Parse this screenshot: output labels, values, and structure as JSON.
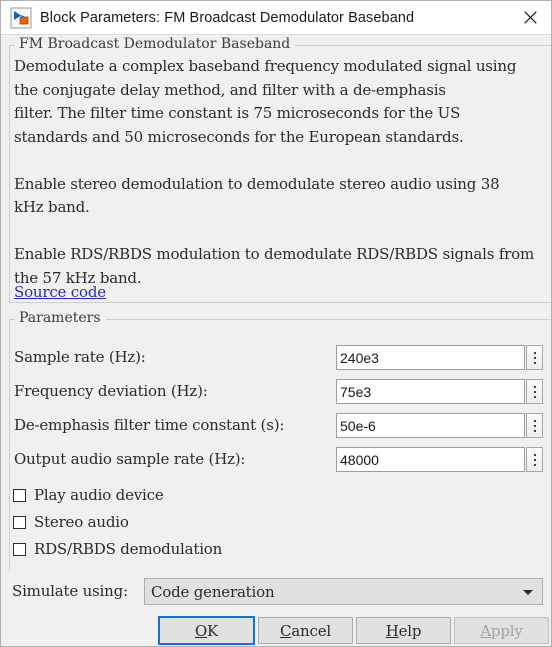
{
  "window": {
    "title": "Block Parameters: FM Broadcast Demodulator Baseband",
    "icon": "simulink-block-icon",
    "close_icon": "close-icon"
  },
  "description": {
    "legend": "FM Broadcast Demodulator Baseband",
    "body": "Demodulate a complex baseband frequency modulated signal using\nthe conjugate delay method, and filter with a de-emphasis\nfilter. The filter time constant is 75 microseconds for the US\nstandards and 50 microseconds for the European standards.\n\nEnable stereo demodulation to demodulate stereo audio using 38\nkHz band.\n\nEnable RDS/RBDS modulation to demodulate RDS/RBDS signals from\nthe 57 kHz band.",
    "source_link": "Source code"
  },
  "parameters": {
    "legend": "Parameters",
    "fields": [
      {
        "label": "Sample rate (Hz):",
        "value": "240e3",
        "spinner_icon": "vertical-ellipsis-icon"
      },
      {
        "label": "Frequency deviation (Hz):",
        "value": "75e3",
        "spinner_icon": "vertical-ellipsis-icon"
      },
      {
        "label": "De-emphasis filter time constant (s):",
        "value": "50e-6",
        "spinner_icon": "vertical-ellipsis-icon"
      },
      {
        "label": "Output audio sample rate (Hz):",
        "value": "48000",
        "spinner_icon": "vertical-ellipsis-icon"
      }
    ],
    "checkboxes": [
      {
        "label": "Play audio device",
        "checked": false
      },
      {
        "label": "Stereo audio",
        "checked": false
      },
      {
        "label": "RDS/RBDS demodulation",
        "checked": false
      }
    ]
  },
  "simulate_using": {
    "label": "Simulate using:",
    "value": "Code generation",
    "arrow_icon": "chevron-down-icon"
  },
  "buttons": [
    {
      "id": "ok",
      "pre": "",
      "mnemonic": "O",
      "post": "K",
      "default": true,
      "disabled": false
    },
    {
      "id": "cancel",
      "pre": "",
      "mnemonic": "C",
      "post": "ancel",
      "default": false,
      "disabled": false
    },
    {
      "id": "help",
      "pre": "",
      "mnemonic": "H",
      "post": "elp",
      "default": false,
      "disabled": false
    },
    {
      "id": "apply",
      "pre": "",
      "mnemonic": "A",
      "post": "pply",
      "default": false,
      "disabled": true
    }
  ],
  "colors": {
    "dialog_background": "#f0f0f0",
    "link": "#2b2bbf",
    "focus_border": "#1573c8",
    "disabled_text": "#a3a3a3"
  }
}
